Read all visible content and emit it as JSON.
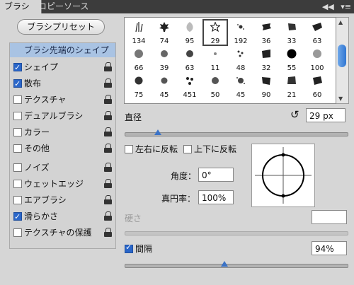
{
  "tabs": [
    {
      "label": "ブラシ"
    },
    {
      "label": "コピーソース"
    }
  ],
  "tab_controls": {
    "collapse": "◀◀",
    "menu": "▾≡"
  },
  "preset_button": "ブラシプリセット",
  "options": {
    "header": "ブラシ先端のシェイプ",
    "items": [
      {
        "label": "シェイプ",
        "checked": true
      },
      {
        "label": "散布",
        "checked": true
      },
      {
        "label": "テクスチャ",
        "checked": false
      },
      {
        "label": "デュアルブラシ",
        "checked": false
      },
      {
        "label": "カラー",
        "checked": false
      },
      {
        "label": "その他",
        "checked": false
      },
      {
        "label": "ノイズ",
        "checked": false
      },
      {
        "label": "ウェットエッジ",
        "checked": false
      },
      {
        "label": "エアブラシ",
        "checked": false
      },
      {
        "label": "滑らかさ",
        "checked": true
      },
      {
        "label": "テクスチャの保護",
        "checked": false
      }
    ]
  },
  "brushes": {
    "row1": [
      "134",
      "74",
      "95",
      "29",
      "192",
      "36",
      "33",
      "63"
    ],
    "row2": [
      "66",
      "39",
      "63",
      "11",
      "48",
      "32",
      "55",
      "100"
    ],
    "row3": [
      "75",
      "45",
      "451",
      "50",
      "45",
      "90",
      "21",
      "60"
    ]
  },
  "diameter": {
    "label": "直径",
    "value": "29 px",
    "slider": 0.15
  },
  "flip": {
    "x_label": "左右に反転",
    "y_label": "上下に反転"
  },
  "angle": {
    "label": "角度：",
    "value": "0°"
  },
  "roundness": {
    "label": "真円率：",
    "value": "100%"
  },
  "hardness": {
    "label": "硬さ",
    "value": ""
  },
  "spacing": {
    "label": "間隔",
    "value": "94%",
    "checked": true,
    "slider": 0.45
  }
}
